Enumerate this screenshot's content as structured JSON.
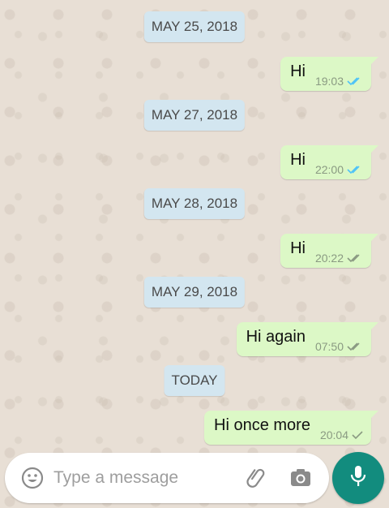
{
  "chat": {
    "messages": [
      {
        "type": "date",
        "label": "MAY 25, 2018"
      },
      {
        "type": "msg",
        "text": "Hi",
        "time": "19:03",
        "status": "read"
      },
      {
        "type": "date",
        "label": "MAY 27, 2018"
      },
      {
        "type": "msg",
        "text": "Hi",
        "time": "22:00",
        "status": "read"
      },
      {
        "type": "date",
        "label": "MAY 28, 2018"
      },
      {
        "type": "msg",
        "text": "Hi",
        "time": "20:22",
        "status": "delivered"
      },
      {
        "type": "date",
        "label": "MAY 29, 2018"
      },
      {
        "type": "msg",
        "text": "Hi again",
        "time": "07:50",
        "status": "delivered"
      },
      {
        "type": "date",
        "label": "TODAY"
      },
      {
        "type": "msg",
        "text": "Hi once more",
        "time": "20:04",
        "status": "sent"
      }
    ]
  },
  "composer": {
    "placeholder": "Type a message",
    "icons": {
      "emoji": "emoji-icon",
      "attach": "paperclip-icon",
      "camera": "camera-icon",
      "mic": "microphone-icon"
    }
  },
  "colors": {
    "bubble": "#dcf8c6",
    "date_chip": "#d3e6f0",
    "read_tick": "#4fc3f7",
    "unread_tick": "#8a9a82",
    "mic_button": "#128c7e"
  }
}
